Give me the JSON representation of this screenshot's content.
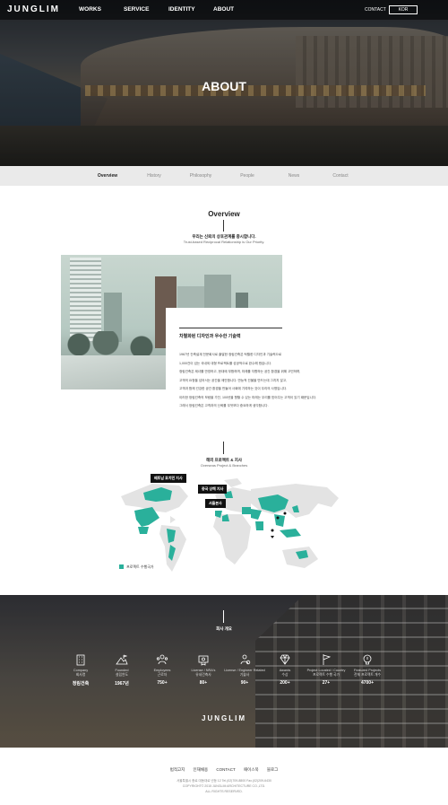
{
  "header": {
    "logo": "JUNGLIM",
    "menu": [
      "WORKS",
      "SERVICE",
      "IDENTITY",
      "ABOUT"
    ],
    "contact": "CONTACT",
    "lang": "KOR",
    "hero_title": "ABOUT"
  },
  "subtabs": [
    "Overview",
    "History",
    "Philosophy",
    "People",
    "News",
    "Contact"
  ],
  "overview": {
    "title": "Overview",
    "sub_ko": "우리는 신뢰의 상호관계를 중시합니다.",
    "sub_en": "Trust-based Reciprocal Relationship is Our Priority.",
    "heading": "차별화된 디자인과 우수한 기술력",
    "paragraphs": [
      "1967년 건축설계 전문회사로 출발한 정림건축은 탁월한 디자인과 기술력으로",
      "1,000건이 넘는 국내외 대형 프로젝트를 성공적으로 완수해 왔습니다.",
      "정림건축은 제녀를 반영하고, 현대에 부합하며, 미래를 지향하는 공간 환경을 위해 고민하며,",
      "고객의 요청을 넘어서는 공간을 제안합니다. 만능적 건물을 만드는데 그치지 않고,",
      "고객과 함께 건강한 공간 환경을 만들어 사회에 기여하는 것이 우리의 사명입니다.",
      "이러한 정림건축의 보람을 가진, 100년을 향할 수 있는 미래는 우리를 믿어주는 고객이 있기 때문입니다.",
      "그래서 정림건축은 고객과의 신뢰를 무엇보다 중요하게 생각합니다."
    ]
  },
  "map": {
    "title": "해외 프로젝트 & 지사",
    "subtitle": "Overseas Project & Branches",
    "labels": [
      "베트남 호치민 지사",
      "중국 상해 지사",
      "서울본사"
    ],
    "legend": "프로젝트 수행국가",
    "colors": {
      "land": "#e3e3e3",
      "project": "#2ab09b"
    }
  },
  "stats": {
    "title": "회사 개요",
    "items": [
      {
        "icon": "building-icon",
        "en": "Company",
        "ko": "회사명",
        "value": "정림건축"
      },
      {
        "icon": "mountain-flag-icon",
        "en": "Founded",
        "ko": "설립연도",
        "value": "1967년"
      },
      {
        "icon": "people-icon",
        "en": "Employees",
        "ko": "근로자",
        "value": "750+"
      },
      {
        "icon": "certificate-icon",
        "en": "License / NRA's",
        "ko": "유네건축사",
        "value": "80+"
      },
      {
        "icon": "engineer-icon",
        "en": "License / Engineer Related",
        "ko": "기술사",
        "value": "90+"
      },
      {
        "icon": "diamond-icon",
        "en": "Awards",
        "ko": "수상",
        "value": "200+"
      },
      {
        "icon": "flag-icon",
        "en": "Project Located / Country",
        "ko": "프로젝트 수행 국가",
        "value": "27+"
      },
      {
        "icon": "lightbulb-icon",
        "en": "Featured Projects",
        "ko": "전체 프로젝트 개수",
        "value": "4700+"
      }
    ],
    "logo": "JUNGLIM"
  },
  "footer": {
    "links": [
      "법적고지",
      "인재채용",
      "CONTACT",
      "패이스북",
      "블로그"
    ],
    "address": "서울특별시 종로 대동대로 년등 12 Tel.(02)709-8800 Fax.(02)209-6430",
    "copyright": "COPYRIGHT© 2015 JUNGLIM ARCHITECTURE CO.,LTD.",
    "rights": "ALL RIGHTS RESERVED."
  }
}
